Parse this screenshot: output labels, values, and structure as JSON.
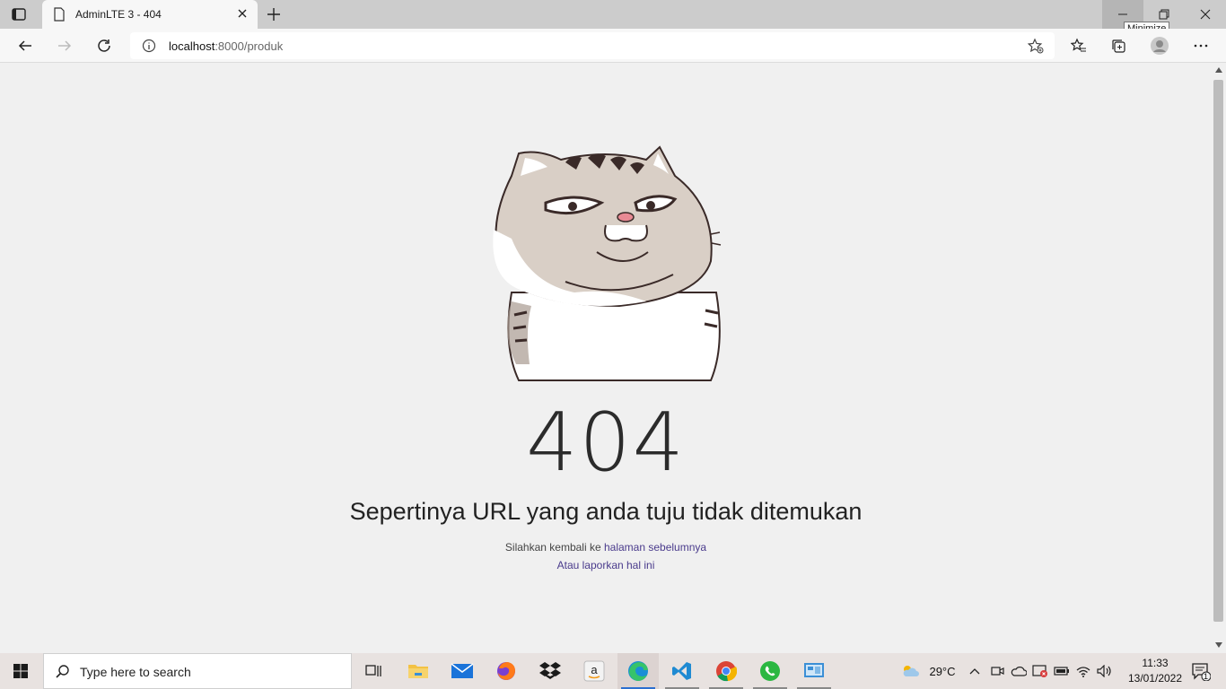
{
  "browser": {
    "tab_title": "AdminLTE 3 - 404",
    "url_host": "localhost",
    "url_rest": ":8000/produk",
    "tooltip": "Minimize"
  },
  "page": {
    "code": "404",
    "headline": "Sepertinya URL yang anda tuju tidak ditemukan",
    "line1_prefix": "Silahkan kembali ke ",
    "line1_link": "halaman sebelumnya",
    "line2_link": "Atau laporkan hal ini"
  },
  "taskbar": {
    "search_placeholder": "Type here to search",
    "weather": "29°C",
    "time": "11:33",
    "date": "13/01/2022",
    "notifications": "1",
    "apps": [
      "task-view",
      "file-explorer",
      "mail",
      "firefox",
      "dropbox",
      "amazon",
      "edge",
      "vscode",
      "chrome",
      "whatsapp",
      "control-panel"
    ]
  },
  "colors": {
    "link": "#4a3b8c",
    "page_bg": "#f0f0f0",
    "titlebar": "#cccccc"
  }
}
